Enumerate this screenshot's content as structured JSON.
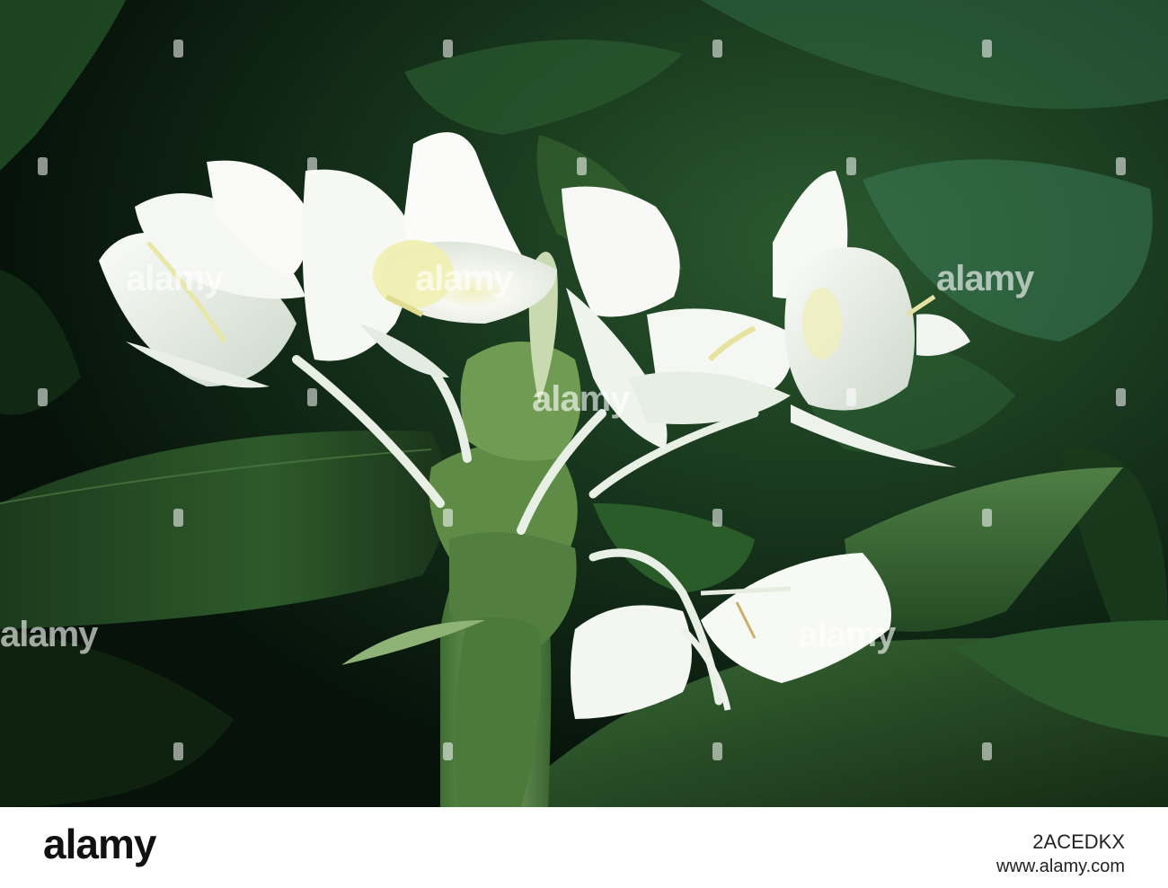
{
  "watermark": {
    "brand": "alamy",
    "color": "#ffffff"
  },
  "footer": {
    "logo": "alamy",
    "image_id": "2ACEDKX",
    "url": "www.alamy.com"
  },
  "photo": {
    "subject": "white flowers with green foliage",
    "colors": {
      "background_dark": "#0c1a0e",
      "leaf": "#2f5a2c",
      "leaf_light": "#5b8a4e",
      "petal": "#f4f6f2",
      "petal_center": "#f1f0b8"
    }
  }
}
